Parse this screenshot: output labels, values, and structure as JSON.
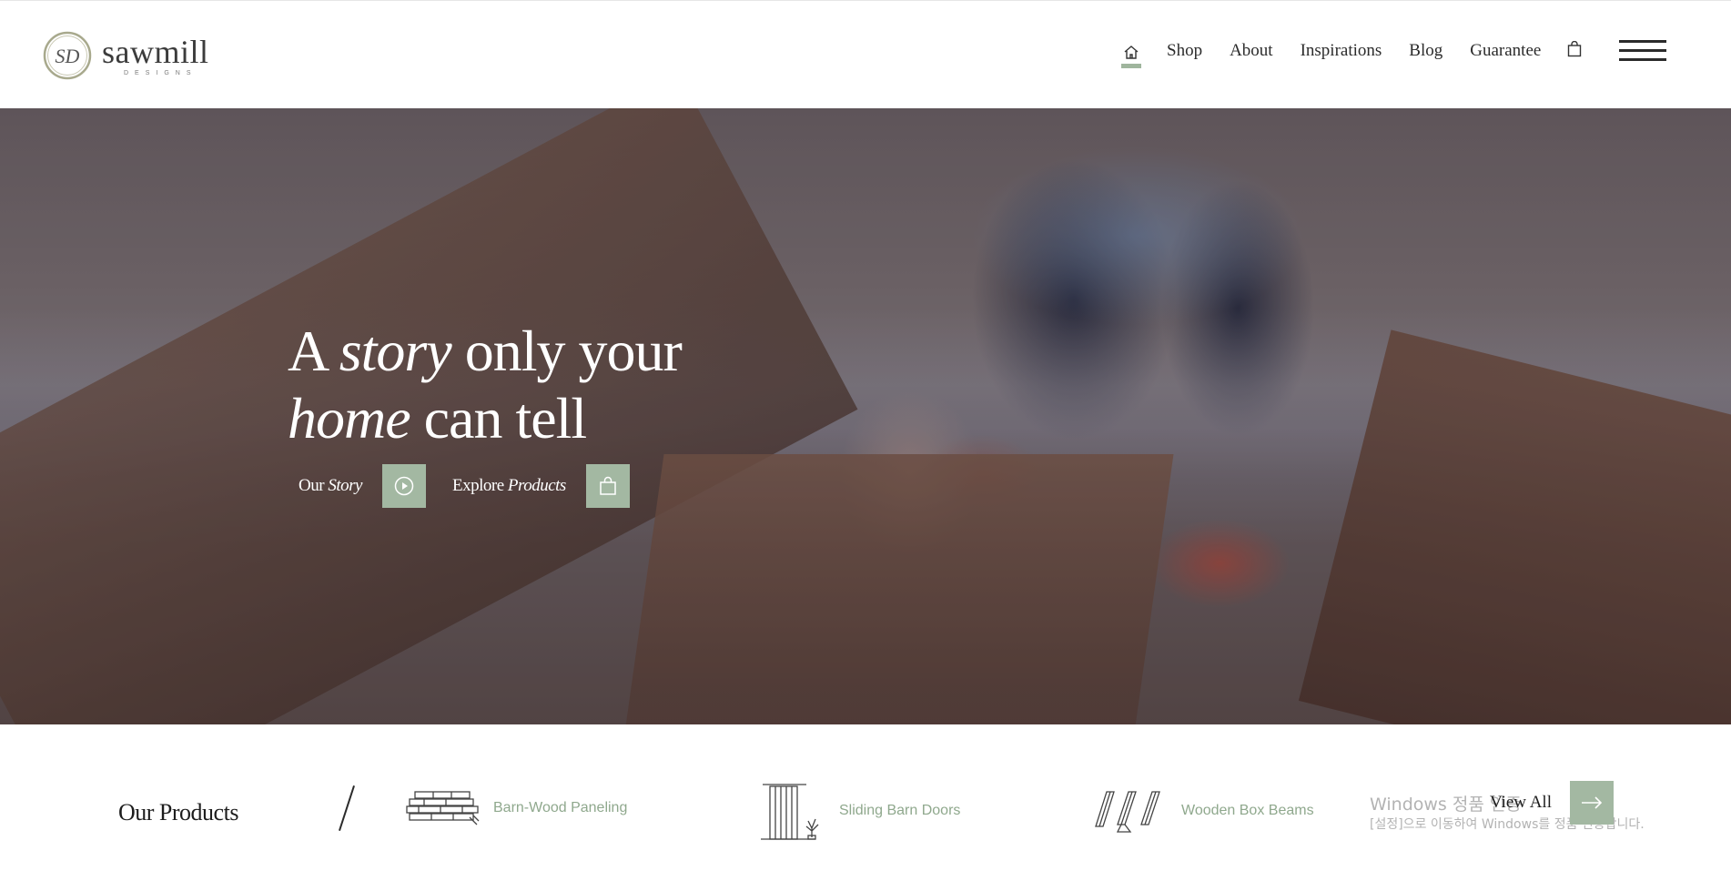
{
  "brand": {
    "name": "sawmill",
    "subtitle": "DESIGNS",
    "monogram": "SD"
  },
  "nav": {
    "home_icon": "home-icon",
    "items": [
      "Shop",
      "About",
      "Inspirations",
      "Blog",
      "Guarantee"
    ],
    "cart_icon": "shopping-bag-icon",
    "menu_icon": "hamburger-menu-icon"
  },
  "hero": {
    "title_line1_pre": "A ",
    "title_line1_em": "story",
    "title_line1_post": " only your",
    "title_line2_em": "home",
    "title_line2_post": " can tell",
    "cta_story_pre": "Our ",
    "cta_story_em": "Story",
    "cta_story_icon": "play-icon",
    "cta_products_pre": "Explore ",
    "cta_products_em": "Products",
    "cta_products_icon": "shopping-bag-icon"
  },
  "products": {
    "title": "Our Products",
    "items": [
      {
        "label": "Barn-Wood Paneling",
        "icon": "paneling-icon"
      },
      {
        "label": "Sliding Barn Doors",
        "icon": "barn-door-icon"
      },
      {
        "label": "Wooden Box Beams",
        "icon": "box-beams-icon"
      }
    ],
    "view_all": "View All",
    "view_all_icon": "arrow-right-icon"
  },
  "os_watermark": {
    "line1": "Windows 정품 인증",
    "line2": "[설정]으로 이동하여 Windows를 정품 인증합니다."
  },
  "colors": {
    "accent": "#a3b8a2",
    "text": "#2b2b2b",
    "product_label": "#8fa88d"
  }
}
